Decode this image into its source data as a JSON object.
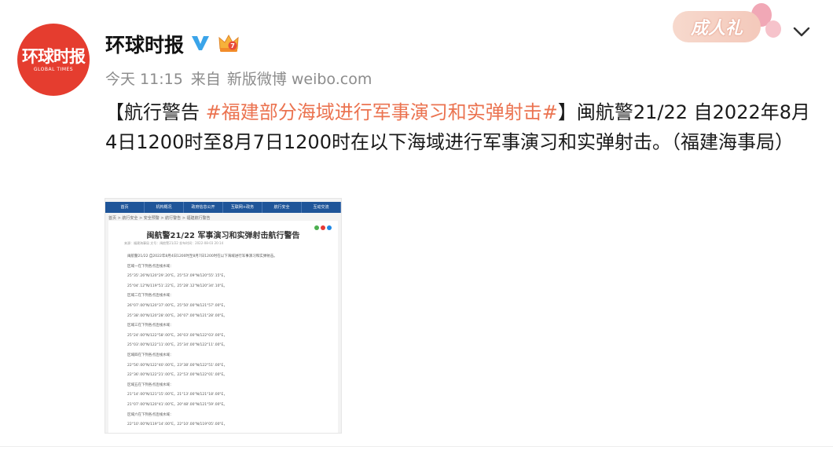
{
  "account": {
    "name": "环球时报",
    "logo_cn": "环球时报",
    "logo_en": "GLOBAL TIMES"
  },
  "meta": {
    "time": "今天 11:15",
    "source_prefix": "来自",
    "source": "新版微博 weibo.com"
  },
  "badge": {
    "label": "成人礼"
  },
  "post": {
    "prefix": "【航行警告 ",
    "hashtag": "#福建部分海域进行军事演习和实弹射击#",
    "body": "】闽航警21/22 自2022年8月4日1200时至8月7日1200时在以下海域进行军事演习和实弹射击。（福建海事局）"
  },
  "thumbnail": {
    "nav_items": [
      "首页",
      "机构概况",
      "政府信息公开",
      "互联网+政务",
      "航行安全",
      "互动交流"
    ],
    "breadcrumb": "首页 > 航行安全 > 安全预警 > 航行警告 > 福建航行警告",
    "title": "闽航警21/22 军事演习和实弹射击航行警告",
    "meta_line": "来源：福建海事局    文号：闽航警21/22    发布时间：2022-08-03 20:14",
    "lines": [
      "闽航警21/22  自2022年8月4日1200时至8月7日1200时在以下海域进行军事演习和实弹射击。",
      "区域一在下列各点连线水域：",
      "25°35'.26\"N/120°29'.20\"E，25°53'.09\"N/120°55'.15\"E，",
      "25°04'.12\"N/119°51'.22\"E，25°28'.12\"N/120°34'.10\"E。",
      "区域二在下列各点连线水域：",
      "26°07'.00\"N/120°37'.00\"E，25°50'.00\"N/121°57'.00\"E，",
      "25°38'.00\"N/120°28'.00\"E，26°07'.00\"N/121°28'.00\"E。",
      "区域三在下列各点连线水域：",
      "25°24'.00\"N/122°58'.00\"E，26°03'.00\"N/122°03'.00\"E，",
      "25°03'.00\"N/122°11'.00\"E，25°34'.00\"N/122°11'.00\"E。",
      "区域四在下列各点连线水域：",
      "22°56'.00\"N/122°40'.00\"E，23°38'.00\"N/122°51'.00\"E，",
      "22°36'.00\"N/122°21'.00\"E，22°53'.00\"N/122°01'.00\"E。",
      "区域五在下列各点连线水域：",
      "21°14'.00\"N/121°15'.00\"E，21°13'.00\"N/121°18'.00\"E，",
      "21°07'.00\"N/120°41'.00\"E，20°48'.00\"N/121°59'.00\"E。",
      "区域六在下列各点连线水域：",
      "22°10'.00\"N/119°14'.00\"E，22°10'.00\"N/119°05'.00\"E，"
    ]
  },
  "colors": {
    "avatar_bg": "#e53d2f",
    "hashtag": "#eb7350",
    "verified": "#3aa4e9",
    "meta_text": "#8c8c8c"
  },
  "icons": {
    "verified": "verified-icon",
    "crown": "crown-icon",
    "more": "chevron-down-icon"
  }
}
